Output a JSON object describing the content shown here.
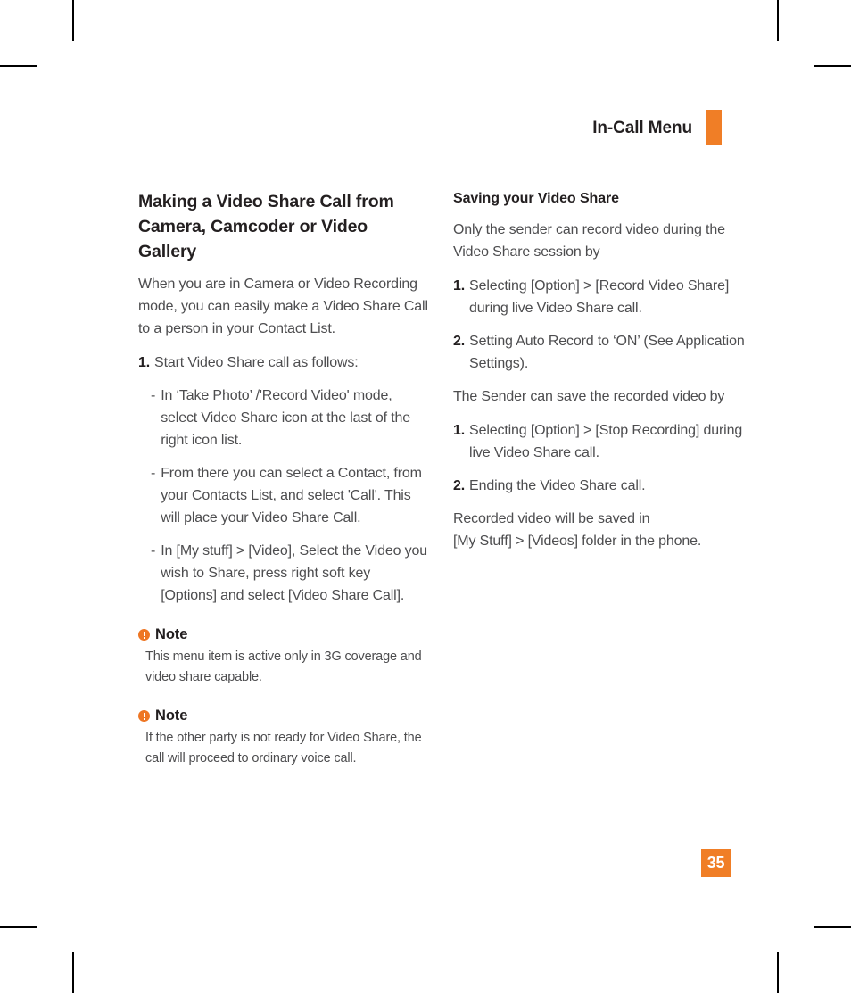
{
  "header": {
    "title": "In-Call Menu"
  },
  "left_column": {
    "section_title": "Making a Video Share Call from Camera, Camcoder or Video Gallery",
    "intro": "When you are in Camera or Video Recording mode, you can easily make a Video Share Call to a person in your Contact List.",
    "step1_marker": "1.",
    "step1_text": "Start Video Share call as follows:",
    "sub_items": [
      {
        "marker": "-",
        "text": "In ‘Take Photo’ /'Record Video' mode, select Video Share icon at the last of the right icon list."
      },
      {
        "marker": "-",
        "text": "From there you can select a Contact, from your Contacts List, and select 'Call'. This will place your Video Share Call."
      },
      {
        "marker": "-",
        "text": "In [My stuff] > [Video], Select the Video you wish to Share, press right soft key [Options] and select [Video Share Call]."
      }
    ],
    "notes": [
      {
        "title": "Note",
        "body": "This menu item is active only in 3G coverage and video share capable."
      },
      {
        "title": "Note",
        "body": "If the other party is not ready for Video Share, the call will proceed to ordinary voice call."
      }
    ]
  },
  "right_column": {
    "section_title": "Saving your Video Share",
    "intro": "Only the sender can record video during the Video Share session by",
    "record_steps": [
      {
        "marker": "1.",
        "text": "Selecting [Option] > [Record Video Share] during live Video Share call."
      },
      {
        "marker": "2.",
        "text": "Setting Auto Record to ‘ON’ (See Application Settings)."
      }
    ],
    "save_intro": "The Sender can save the recorded video by",
    "save_steps": [
      {
        "marker": "1.",
        "text": "Selecting [Option] > [Stop Recording] during live Video Share call."
      },
      {
        "marker": "2.",
        "text": "Ending the Video Share call."
      }
    ],
    "closing_line1": "Recorded video will be saved in",
    "closing_line2": "[My Stuff] > [Videos] folder in the phone."
  },
  "footer": {
    "page_number": "35"
  },
  "colors": {
    "accent": "#F07E26",
    "note_icon": "#EE7624",
    "heading": "#231f20",
    "body": "#4d4d4f"
  }
}
